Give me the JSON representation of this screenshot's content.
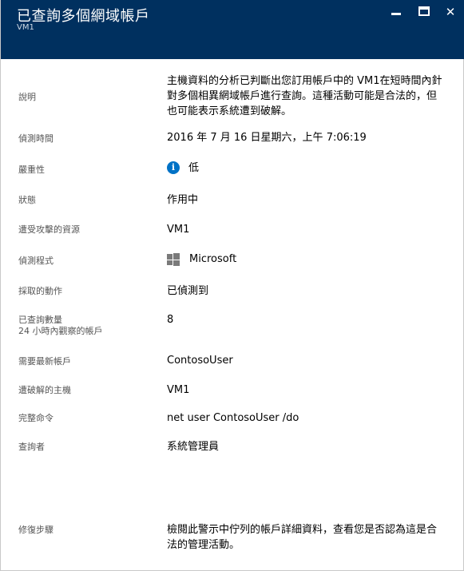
{
  "window": {
    "title": "已查詢多個網域帳戶",
    "subtitle": "VM1",
    "close_glyph": "✕"
  },
  "details": {
    "description_label": "說明",
    "description_value": "主機資料的分析已判斷出您訂用帳戶中的 VM1在短時間內針對多個相異網域帳戶進行查詢。這種活動可能是合法的，但也可能表示系統遭到破解。",
    "detection_time_label": "偵測時間",
    "detection_time_value": "2016 年 7 月 16 日星期六，上午 7:06:19",
    "severity_label": "嚴重性",
    "severity_value": "低",
    "status_label": "狀態",
    "status_value": "作用中",
    "attacked_resource_label": "遭受攻擊的資源",
    "attacked_resource_value": "VM1",
    "detector_label": "偵測程式",
    "detector_value": "Microsoft",
    "action_taken_label": "採取的動作",
    "action_taken_value": "已偵測到",
    "query_count_label": "已查詢數量",
    "query_count_sublabel": "24 小時內觀察的帳戶",
    "query_count_value": "8",
    "latest_account_label": "需要最新帳戶",
    "latest_account_value": "ContosoUser",
    "compromised_host_label": "遭破解的主機",
    "compromised_host_value": "VM1",
    "full_command_label": "完整命令",
    "full_command_value": "net user ContosoUser /do",
    "queried_by_label": "查詢者",
    "queried_by_value": "系統管理員",
    "remediation_label": "修復步驟",
    "remediation_value": "檢閱此警示中佇列的帳戶詳細資料，查看您是否認為這是合法的管理活動。"
  },
  "icons": {
    "severity": "info-icon",
    "detector": "windows-logo-icon"
  },
  "colors": {
    "titlebar": "#00305f",
    "info": "#0072c6"
  }
}
